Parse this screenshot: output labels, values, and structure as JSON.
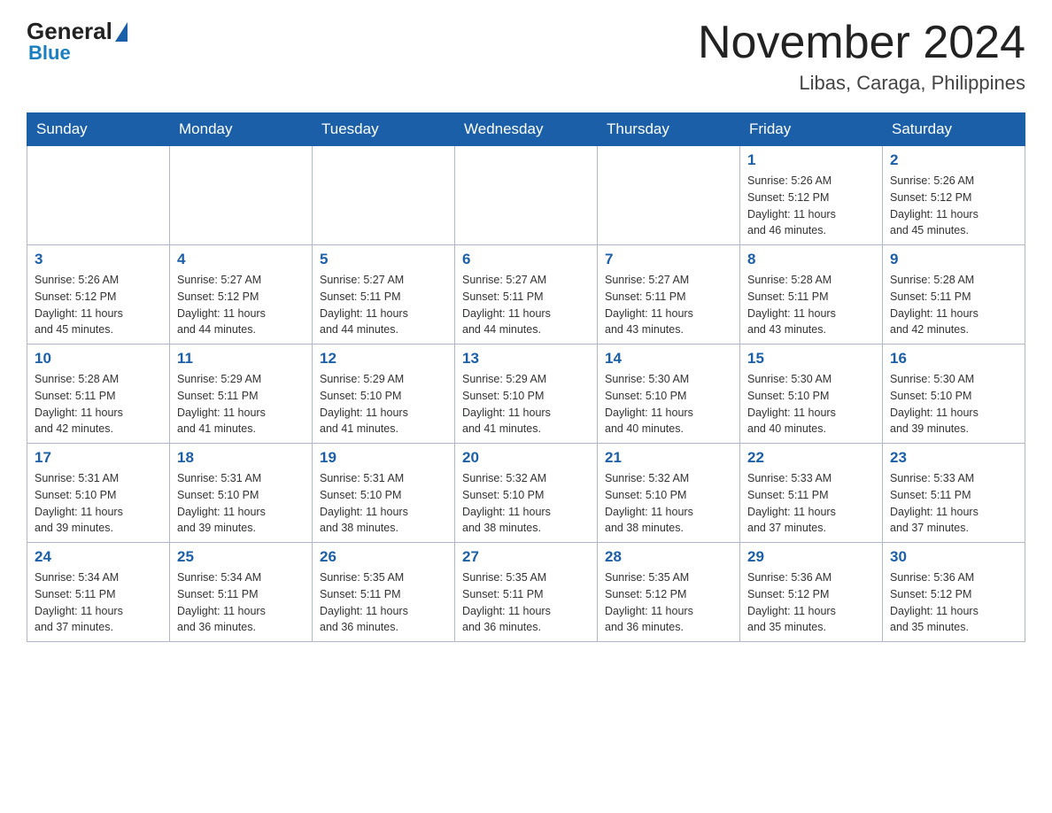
{
  "logo": {
    "general_text": "General",
    "blue_text": "Blue"
  },
  "header": {
    "month_title": "November 2024",
    "location": "Libas, Caraga, Philippines"
  },
  "days_of_week": [
    "Sunday",
    "Monday",
    "Tuesday",
    "Wednesday",
    "Thursday",
    "Friday",
    "Saturday"
  ],
  "weeks": [
    [
      {
        "day": "",
        "info": ""
      },
      {
        "day": "",
        "info": ""
      },
      {
        "day": "",
        "info": ""
      },
      {
        "day": "",
        "info": ""
      },
      {
        "day": "",
        "info": ""
      },
      {
        "day": "1",
        "info": "Sunrise: 5:26 AM\nSunset: 5:12 PM\nDaylight: 11 hours\nand 46 minutes."
      },
      {
        "day": "2",
        "info": "Sunrise: 5:26 AM\nSunset: 5:12 PM\nDaylight: 11 hours\nand 45 minutes."
      }
    ],
    [
      {
        "day": "3",
        "info": "Sunrise: 5:26 AM\nSunset: 5:12 PM\nDaylight: 11 hours\nand 45 minutes."
      },
      {
        "day": "4",
        "info": "Sunrise: 5:27 AM\nSunset: 5:12 PM\nDaylight: 11 hours\nand 44 minutes."
      },
      {
        "day": "5",
        "info": "Sunrise: 5:27 AM\nSunset: 5:11 PM\nDaylight: 11 hours\nand 44 minutes."
      },
      {
        "day": "6",
        "info": "Sunrise: 5:27 AM\nSunset: 5:11 PM\nDaylight: 11 hours\nand 44 minutes."
      },
      {
        "day": "7",
        "info": "Sunrise: 5:27 AM\nSunset: 5:11 PM\nDaylight: 11 hours\nand 43 minutes."
      },
      {
        "day": "8",
        "info": "Sunrise: 5:28 AM\nSunset: 5:11 PM\nDaylight: 11 hours\nand 43 minutes."
      },
      {
        "day": "9",
        "info": "Sunrise: 5:28 AM\nSunset: 5:11 PM\nDaylight: 11 hours\nand 42 minutes."
      }
    ],
    [
      {
        "day": "10",
        "info": "Sunrise: 5:28 AM\nSunset: 5:11 PM\nDaylight: 11 hours\nand 42 minutes."
      },
      {
        "day": "11",
        "info": "Sunrise: 5:29 AM\nSunset: 5:11 PM\nDaylight: 11 hours\nand 41 minutes."
      },
      {
        "day": "12",
        "info": "Sunrise: 5:29 AM\nSunset: 5:10 PM\nDaylight: 11 hours\nand 41 minutes."
      },
      {
        "day": "13",
        "info": "Sunrise: 5:29 AM\nSunset: 5:10 PM\nDaylight: 11 hours\nand 41 minutes."
      },
      {
        "day": "14",
        "info": "Sunrise: 5:30 AM\nSunset: 5:10 PM\nDaylight: 11 hours\nand 40 minutes."
      },
      {
        "day": "15",
        "info": "Sunrise: 5:30 AM\nSunset: 5:10 PM\nDaylight: 11 hours\nand 40 minutes."
      },
      {
        "day": "16",
        "info": "Sunrise: 5:30 AM\nSunset: 5:10 PM\nDaylight: 11 hours\nand 39 minutes."
      }
    ],
    [
      {
        "day": "17",
        "info": "Sunrise: 5:31 AM\nSunset: 5:10 PM\nDaylight: 11 hours\nand 39 minutes."
      },
      {
        "day": "18",
        "info": "Sunrise: 5:31 AM\nSunset: 5:10 PM\nDaylight: 11 hours\nand 39 minutes."
      },
      {
        "day": "19",
        "info": "Sunrise: 5:31 AM\nSunset: 5:10 PM\nDaylight: 11 hours\nand 38 minutes."
      },
      {
        "day": "20",
        "info": "Sunrise: 5:32 AM\nSunset: 5:10 PM\nDaylight: 11 hours\nand 38 minutes."
      },
      {
        "day": "21",
        "info": "Sunrise: 5:32 AM\nSunset: 5:10 PM\nDaylight: 11 hours\nand 38 minutes."
      },
      {
        "day": "22",
        "info": "Sunrise: 5:33 AM\nSunset: 5:11 PM\nDaylight: 11 hours\nand 37 minutes."
      },
      {
        "day": "23",
        "info": "Sunrise: 5:33 AM\nSunset: 5:11 PM\nDaylight: 11 hours\nand 37 minutes."
      }
    ],
    [
      {
        "day": "24",
        "info": "Sunrise: 5:34 AM\nSunset: 5:11 PM\nDaylight: 11 hours\nand 37 minutes."
      },
      {
        "day": "25",
        "info": "Sunrise: 5:34 AM\nSunset: 5:11 PM\nDaylight: 11 hours\nand 36 minutes."
      },
      {
        "day": "26",
        "info": "Sunrise: 5:35 AM\nSunset: 5:11 PM\nDaylight: 11 hours\nand 36 minutes."
      },
      {
        "day": "27",
        "info": "Sunrise: 5:35 AM\nSunset: 5:11 PM\nDaylight: 11 hours\nand 36 minutes."
      },
      {
        "day": "28",
        "info": "Sunrise: 5:35 AM\nSunset: 5:12 PM\nDaylight: 11 hours\nand 36 minutes."
      },
      {
        "day": "29",
        "info": "Sunrise: 5:36 AM\nSunset: 5:12 PM\nDaylight: 11 hours\nand 35 minutes."
      },
      {
        "day": "30",
        "info": "Sunrise: 5:36 AM\nSunset: 5:12 PM\nDaylight: 11 hours\nand 35 minutes."
      }
    ]
  ]
}
